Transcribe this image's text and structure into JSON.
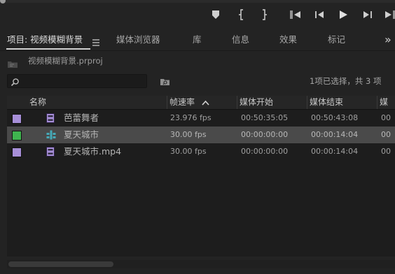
{
  "panel_tabs": [
    {
      "label": "项目: 视频模糊背景",
      "active": true
    },
    {
      "label": "媒体浏览器"
    },
    {
      "label": "库"
    },
    {
      "label": "信息"
    },
    {
      "label": "效果"
    },
    {
      "label": "标记"
    }
  ],
  "overflow_label": "»",
  "project_file": "视频模糊背景.prproj",
  "search": {
    "value": "",
    "placeholder": ""
  },
  "selection_status": "1项已选择，共 3 项",
  "table": {
    "columns": [
      "名称",
      "帧速率",
      "媒体开始",
      "媒体结束",
      "媒"
    ],
    "rows": [
      {
        "color": "#a78fd8",
        "type": "sequence",
        "name": "芭蕾舞者",
        "fps": "23.976 fps",
        "start": "00:50:35:05",
        "end": "00:50:43:08",
        "extra": "00"
      },
      {
        "color": "#3fb44f",
        "type": "multicam",
        "name": "夏天城市",
        "fps": "30.00 fps",
        "start": "00:00:00:00",
        "end": "00:00:14:04",
        "extra": "00",
        "selected": true
      },
      {
        "color": "#a78fd8",
        "type": "clip",
        "name": "夏天城市.mp4",
        "fps": "30.00 fps",
        "start": "00:00:00:00",
        "end": "00:00:14:04",
        "extra": "00"
      }
    ]
  },
  "colors": {
    "selected_row": "#4a4a4a",
    "label_violet": "#a78fd8",
    "label_green": "#3fb44f"
  },
  "icons": {
    "transport": [
      "add-marker-icon",
      "mark-in-icon",
      "mark-out-icon",
      "go-to-in-icon",
      "step-back-icon",
      "play-icon",
      "step-forward-icon",
      "go-to-out-icon"
    ]
  }
}
